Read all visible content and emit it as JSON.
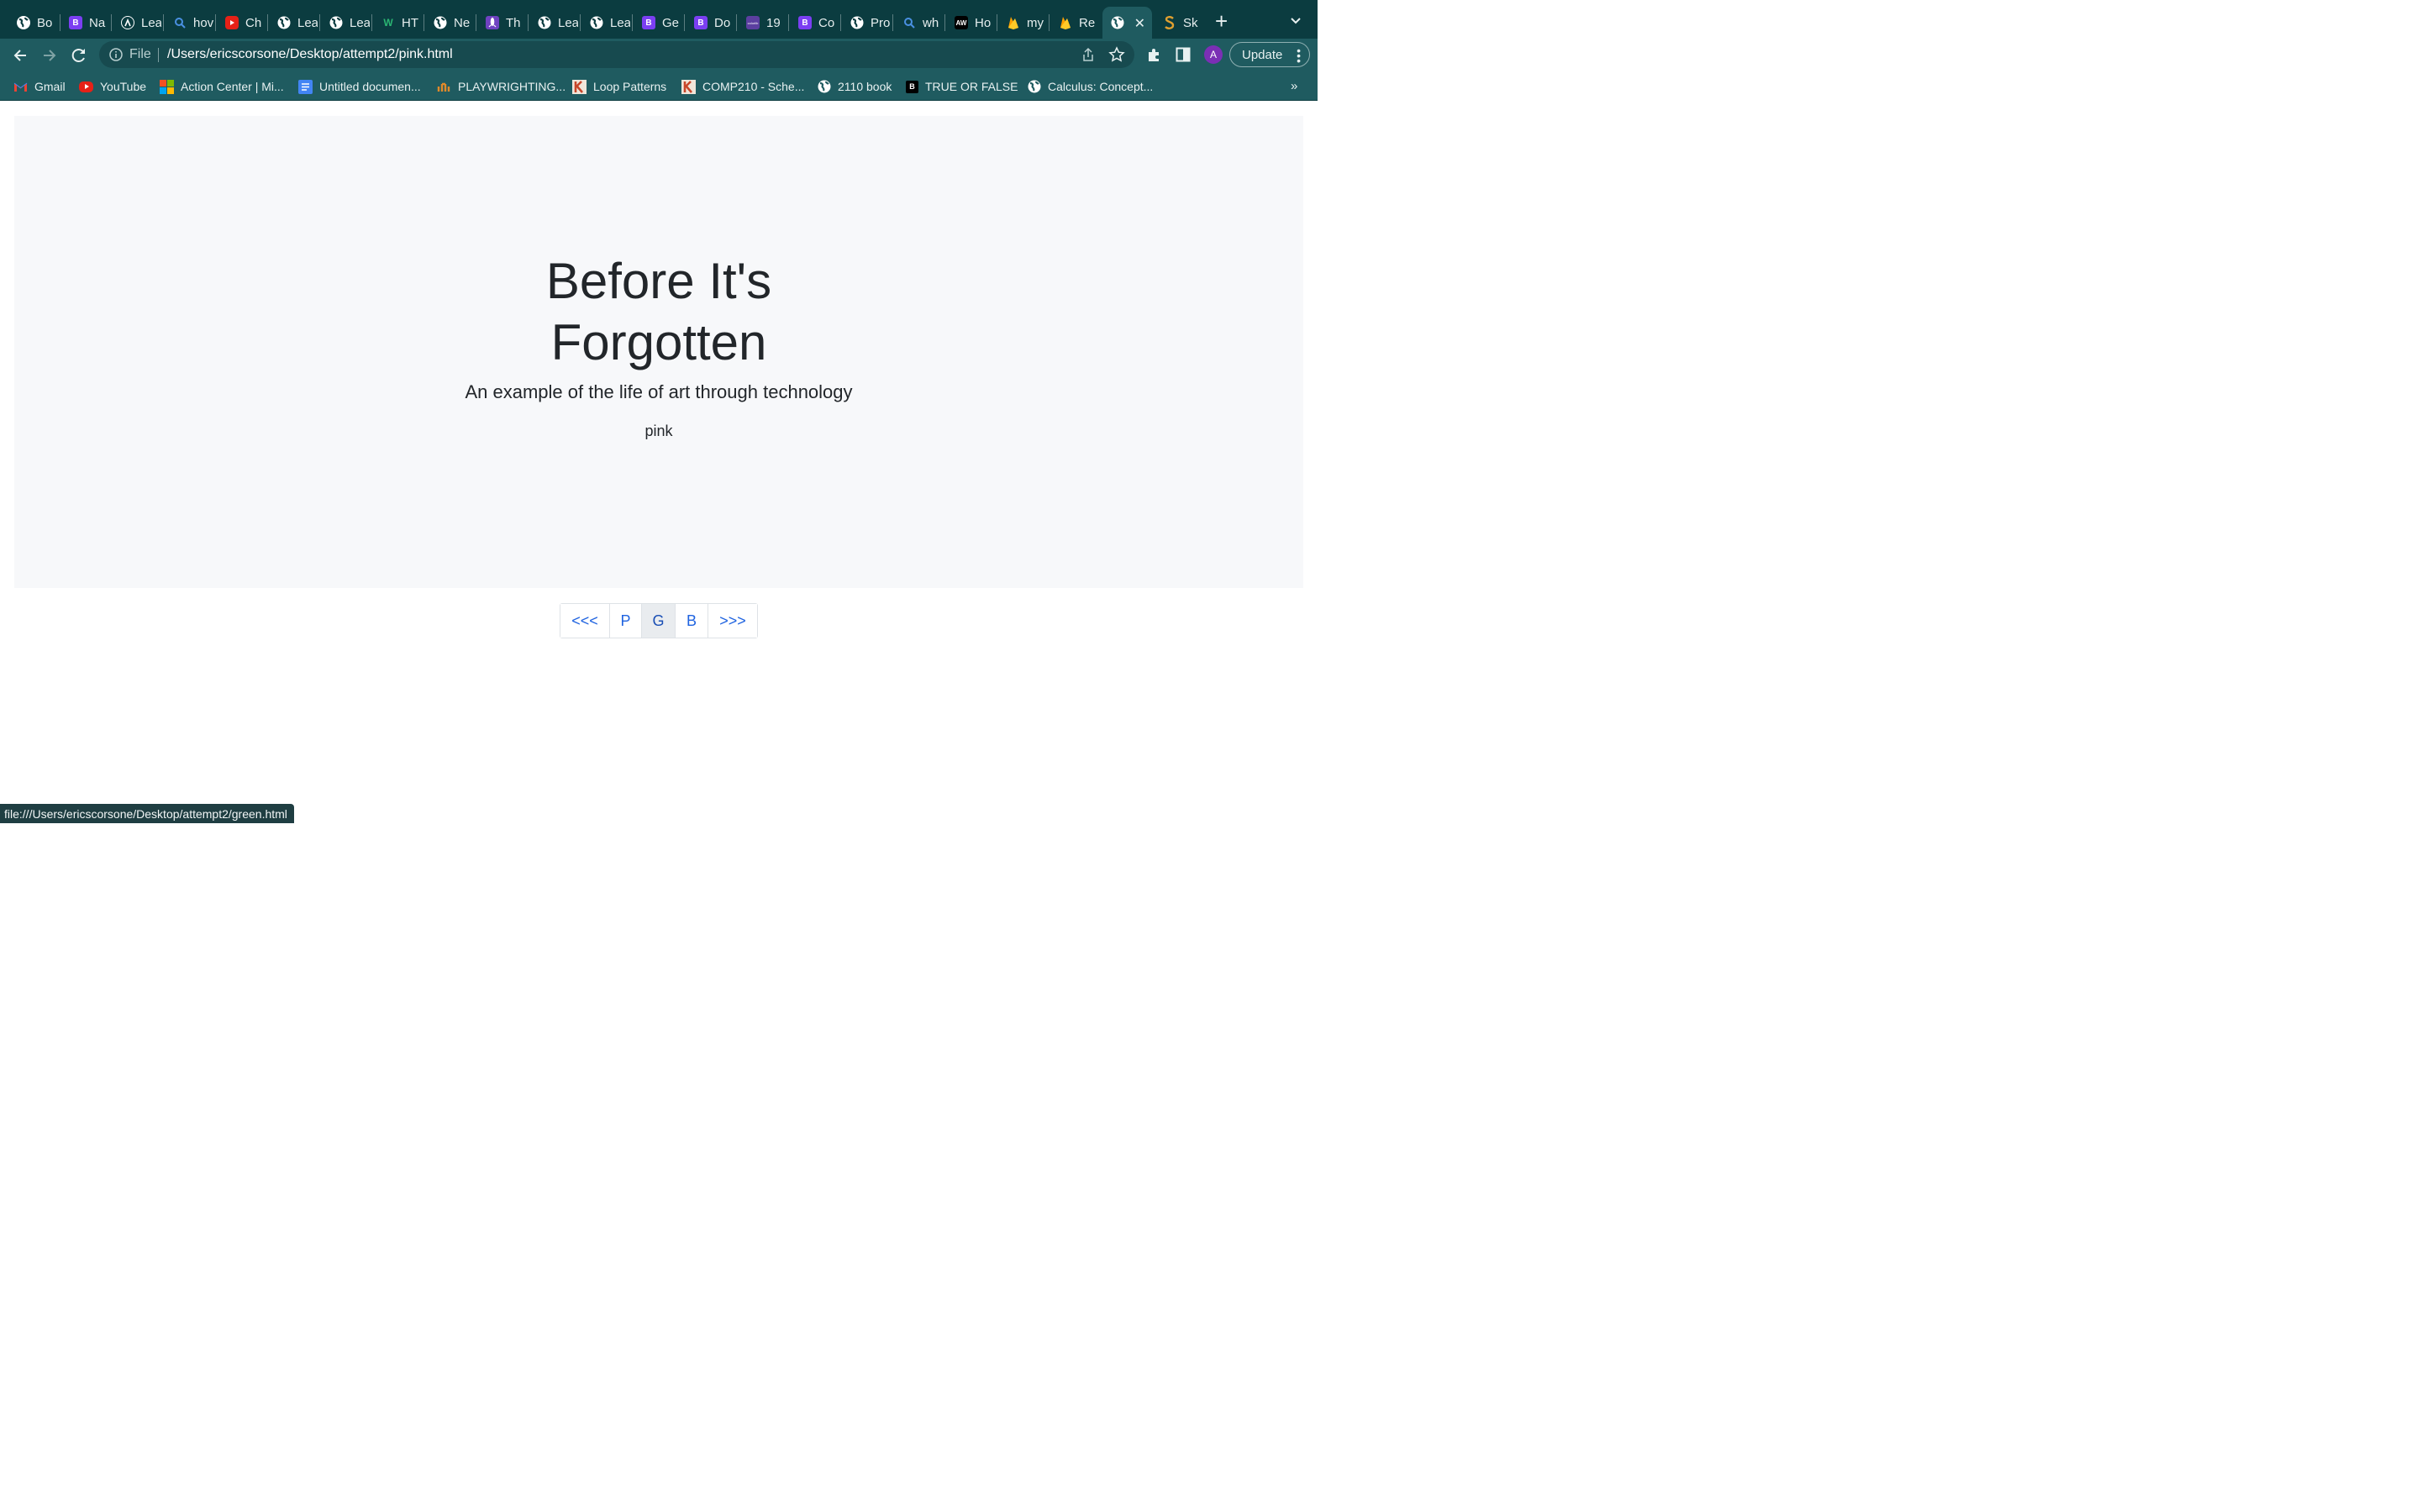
{
  "tabs": [
    {
      "title": "Bo",
      "icon": "globe-icon"
    },
    {
      "title": "Na",
      "icon": "bootstrap-icon"
    },
    {
      "title": "Lea",
      "icon": "lambda-icon"
    },
    {
      "title": "hov",
      "icon": "search-icon"
    },
    {
      "title": "Ch",
      "icon": "youtube-icon"
    },
    {
      "title": "Lea",
      "icon": "globe-icon"
    },
    {
      "title": "Lea",
      "icon": "globe-icon"
    },
    {
      "title": "HT",
      "icon": "w3-icon"
    },
    {
      "title": "Ne",
      "icon": "globe-icon"
    },
    {
      "title": "Th",
      "icon": "rocket-icon"
    },
    {
      "title": "Lea",
      "icon": "globe-icon"
    },
    {
      "title": "Lea",
      "icon": "globe-icon"
    },
    {
      "title": "Ge",
      "icon": "bootstrap-icon"
    },
    {
      "title": "Do",
      "icon": "bootstrap-icon"
    },
    {
      "title": "19",
      "icon": "colorlib-icon"
    },
    {
      "title": "Co",
      "icon": "bootstrap-icon"
    },
    {
      "title": "Pro",
      "icon": "globe-icon"
    },
    {
      "title": "wh",
      "icon": "search-icon"
    },
    {
      "title": "Ho",
      "icon": "aw-icon"
    },
    {
      "title": "my",
      "icon": "firebase-icon"
    },
    {
      "title": "Re",
      "icon": "firebase-icon"
    },
    {
      "title": "",
      "icon": "globe-icon",
      "active": true
    },
    {
      "title": "Sk",
      "icon": "sketch-icon"
    }
  ],
  "tab_icon_text": {
    "bootstrap": "B",
    "aw": "AW",
    "colorlib": "colorlib"
  },
  "toolbar": {
    "omnibox_scheme": "File",
    "url": "/Users/ericscorsone/Desktop/attempt2/pink.html",
    "profile_initial": "A",
    "update_label": "Update"
  },
  "bookmarks": [
    {
      "label": "Gmail",
      "icon": "gmail-icon"
    },
    {
      "label": "YouTube",
      "icon": "youtube-icon"
    },
    {
      "label": "Action Center | Mi...",
      "icon": "microsoft-icon"
    },
    {
      "label": "Untitled documen...",
      "icon": "google-docs-icon"
    },
    {
      "label": "PLAYWRIGHTING...",
      "icon": "playwrighting-icon"
    },
    {
      "label": "Loop Patterns",
      "icon": "k-icon"
    },
    {
      "label": "COMP210 - Sche...",
      "icon": "k-icon"
    },
    {
      "label": "2110 book",
      "icon": "globe-icon"
    },
    {
      "label": "TRUE OR FALSE",
      "icon": "b-logo-icon"
    },
    {
      "label": "Calculus: Concept...",
      "icon": "globe-icon"
    }
  ],
  "bookmarks_overflow": "»",
  "page": {
    "title_line1": "Before It's",
    "title_line2": "Forgotten",
    "subtitle": "An example of the life of art through technology",
    "color_name": "pink"
  },
  "pagination": [
    {
      "label": "<<<"
    },
    {
      "label": "P"
    },
    {
      "label": "G",
      "hovered": true
    },
    {
      "label": "B"
    },
    {
      "label": ">>>"
    }
  ],
  "status_url": "file:///Users/ericscorsone/Desktop/attempt2/green.html",
  "colors": {
    "tabstrip": "#0b3c40",
    "toolbar": "#1f5b60",
    "jumbotron": "#f7f8fa",
    "link": "#1f63e0",
    "text": "#22262a"
  }
}
